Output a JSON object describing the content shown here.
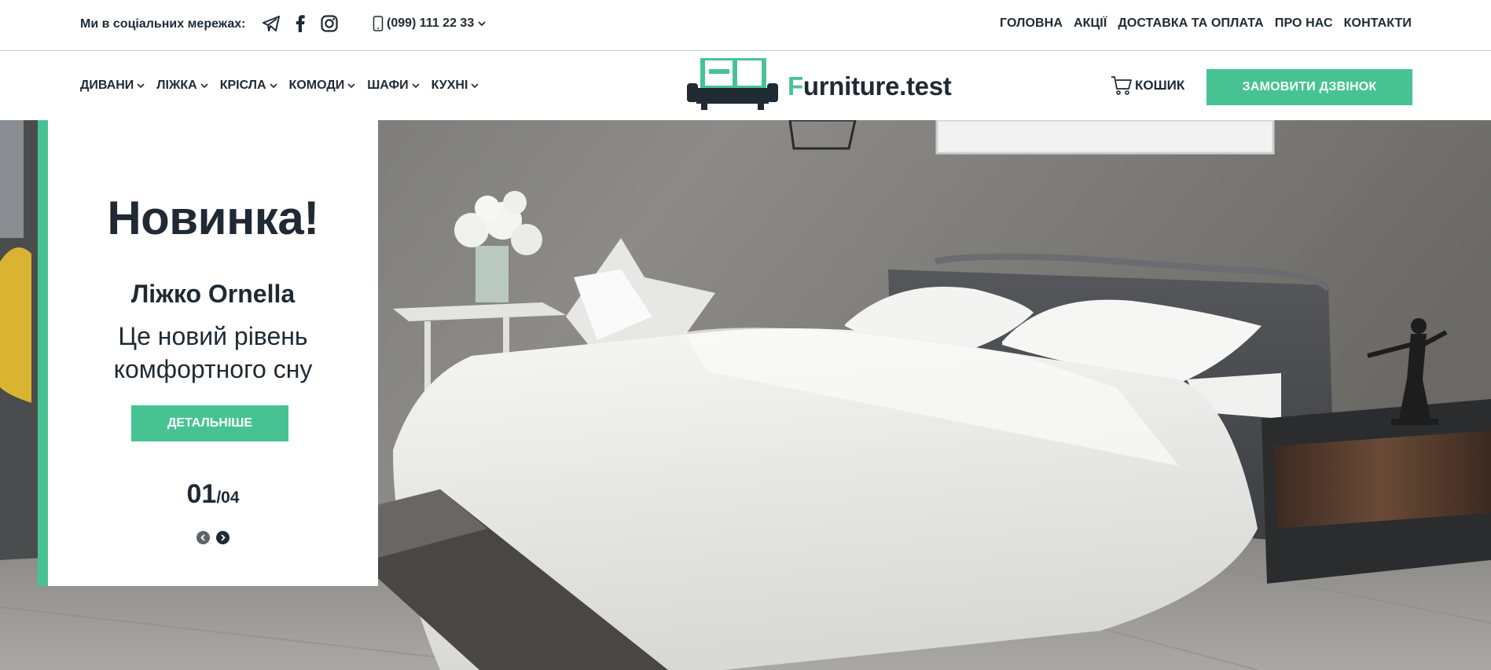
{
  "colors": {
    "accent": "#47c393",
    "dark": "#1f2a33"
  },
  "topbar": {
    "social_label": "Ми в соціальних мережах:",
    "social_icons": [
      "telegram-icon",
      "facebook-icon",
      "instagram-icon"
    ],
    "phone": "(099) 111 22 33",
    "nav": [
      "ГОЛОВНА",
      "АКЦІЇ",
      "ДОСТАВКА ТА ОПЛАТА",
      "ПРО НАС",
      "КОНТАКТИ"
    ]
  },
  "header": {
    "categories": [
      "ДИВАНИ",
      "ЛІЖКА",
      "КРІСЛА",
      "КОМОДИ",
      "ШАФИ",
      "КУХНІ"
    ],
    "logo_first": "F",
    "logo_rest": "urniture.test",
    "cart": "КОШИК",
    "call_button": "ЗАМОВИТИ ДЗВІНОК"
  },
  "slider": {
    "badge": "Новинка!",
    "title": "Ліжко Ornella",
    "description": "Це новий рівень комфортного сну",
    "button": "ДЕТАЛЬНІШЕ",
    "current": "01",
    "total": "/04"
  }
}
